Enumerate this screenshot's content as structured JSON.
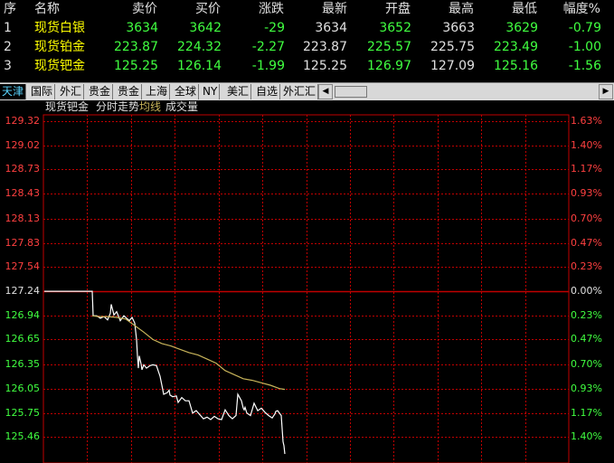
{
  "quote_table": {
    "headers": [
      "序",
      "名称",
      "卖价",
      "买价",
      "涨跌",
      "最新",
      "开盘",
      "最高",
      "最低",
      "幅度%"
    ],
    "rows": [
      {
        "idx": "1",
        "name": "现货白银",
        "sell": "3634",
        "buy": "3642",
        "change": "-29",
        "latest": "3634",
        "open": "3652",
        "high": "3663",
        "low": "3629",
        "pct": "-0.79"
      },
      {
        "idx": "2",
        "name": "现货铂金",
        "sell": "223.87",
        "buy": "224.32",
        "change": "-2.27",
        "latest": "223.87",
        "open": "225.57",
        "high": "225.75",
        "low": "223.49",
        "pct": "-1.00"
      },
      {
        "idx": "3",
        "name": "现货钯金",
        "sell": "125.25",
        "buy": "126.14",
        "change": "-1.99",
        "latest": "125.25",
        "open": "126.97",
        "high": "127.09",
        "low": "125.16",
        "pct": "-1.56"
      }
    ]
  },
  "tabs": [
    "天津",
    "国际",
    "外汇",
    "贵金",
    "贵金",
    "上海",
    "全球",
    "NY",
    "美汇",
    "自选",
    "外汇汇"
  ],
  "active_tab": "天津",
  "scroll_left_icon": "triangle-left",
  "scroll_right_icon": "triangle-right",
  "legend": {
    "name": "现货钯金",
    "mode": "分时走势",
    "avg": "均线",
    "volume": "成交量"
  },
  "colors": {
    "price_line": "#ffffff",
    "avg_line": "#c8b45a",
    "grid": "#c00000",
    "up": "#ff4040",
    "down": "#40ff40",
    "name": "#ffff00",
    "flat": "#e0e0e0"
  },
  "chart_data": {
    "type": "line",
    "title": "现货钯金",
    "ylim": [
      125.46,
      129.32
    ],
    "baseline": 127.24,
    "y_ticks": [
      "129.32",
      "129.02",
      "128.73",
      "128.43",
      "128.13",
      "127.83",
      "127.54",
      "127.24",
      "126.94",
      "126.65",
      "126.35",
      "126.05",
      "125.75",
      "125.46"
    ],
    "pct_ticks": [
      "1.63%",
      "1.40%",
      "1.17%",
      "0.93%",
      "0.70%",
      "0.47%",
      "0.23%",
      "0.00%",
      "0.23%",
      "0.47%",
      "0.70%",
      "0.93%",
      "1.17%",
      "1.40%"
    ],
    "x_count": 580,
    "series": [
      {
        "name": "分时走势",
        "x": [
          0,
          53,
          54,
          58,
          62,
          66,
          70,
          73,
          74,
          77,
          80,
          84,
          88,
          91,
          94,
          97,
          100,
          102,
          103,
          104,
          105,
          107,
          108,
          110,
          113,
          117,
          120,
          124,
          128,
          132,
          136,
          138,
          139,
          142,
          146,
          148,
          152,
          156,
          160,
          164,
          168,
          172,
          176,
          180,
          184,
          188,
          192,
          196,
          200,
          204,
          208,
          212,
          214,
          218,
          220,
          221,
          222,
          224,
          228,
          232,
          236,
          240,
          244,
          248,
          252,
          255,
          256,
          258,
          262,
          264,
          265,
          266
        ],
        "y": [
          127.24,
          127.24,
          126.94,
          126.94,
          126.91,
          126.93,
          126.89,
          126.97,
          127.08,
          126.95,
          126.99,
          126.88,
          126.94,
          126.91,
          126.88,
          126.92,
          126.85,
          126.65,
          126.45,
          126.3,
          126.45,
          126.35,
          126.28,
          126.34,
          126.3,
          126.33,
          126.34,
          126.33,
          126.2,
          125.98,
          126.0,
          126.03,
          125.97,
          125.95,
          125.96,
          125.88,
          125.94,
          125.9,
          125.9,
          125.75,
          125.78,
          125.73,
          125.68,
          125.7,
          125.67,
          125.71,
          125.68,
          125.67,
          125.79,
          125.72,
          125.68,
          125.72,
          125.98,
          125.9,
          125.81,
          125.79,
          125.82,
          125.75,
          125.72,
          125.87,
          125.78,
          125.81,
          125.76,
          125.72,
          125.69,
          125.74,
          125.77,
          125.78,
          125.72,
          125.4,
          125.35,
          125.25
        ]
      },
      {
        "name": "均线",
        "x": [
          53,
          60,
          70,
          80,
          90,
          100,
          110,
          120,
          130,
          140,
          150,
          160,
          170,
          180,
          190,
          200,
          210,
          220,
          230,
          240,
          250,
          260,
          266
        ],
        "y": [
          126.94,
          126.93,
          126.93,
          126.92,
          126.9,
          126.82,
          126.74,
          126.65,
          126.6,
          126.57,
          126.53,
          126.49,
          126.46,
          126.41,
          126.36,
          126.27,
          126.22,
          126.17,
          126.15,
          126.12,
          126.09,
          126.05,
          126.04
        ]
      }
    ]
  }
}
